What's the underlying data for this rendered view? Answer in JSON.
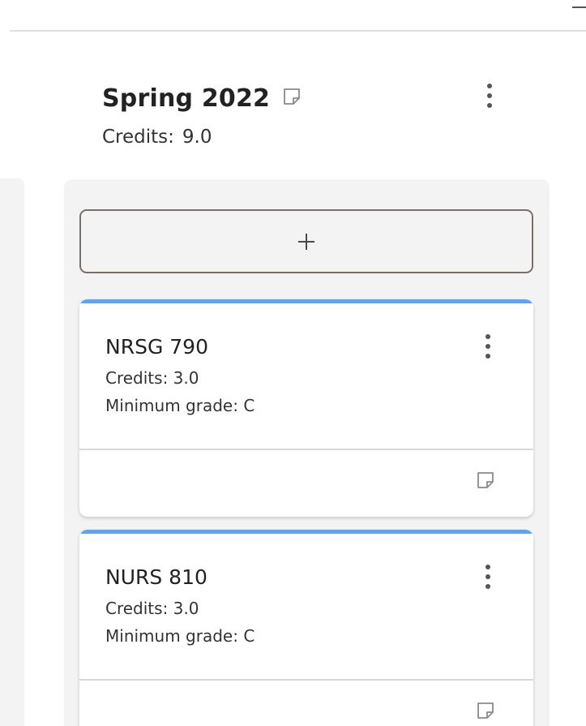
{
  "term": {
    "title": "Spring 2022",
    "credits_label": "Credits:",
    "credits_value": "9.0",
    "note_icon": "sticky-note-icon",
    "menu_icon": "more-vertical-icon"
  },
  "add_course": {
    "label": "+"
  },
  "courses": [
    {
      "code": "NRSG 790",
      "credits": "Credits: 3.0",
      "minimum_grade": "Minimum grade: C",
      "menu_icon": "more-vertical-icon",
      "note_icon": "sticky-note-icon"
    },
    {
      "code": "NURS 810",
      "credits": "Credits: 3.0",
      "minimum_grade": "Minimum grade: C",
      "menu_icon": "more-vertical-icon",
      "note_icon": "sticky-note-icon"
    }
  ],
  "colors": {
    "card_accent": "#5aa6f0",
    "column_background": "#f3f3f3",
    "add_button_border": "#7a7068"
  }
}
